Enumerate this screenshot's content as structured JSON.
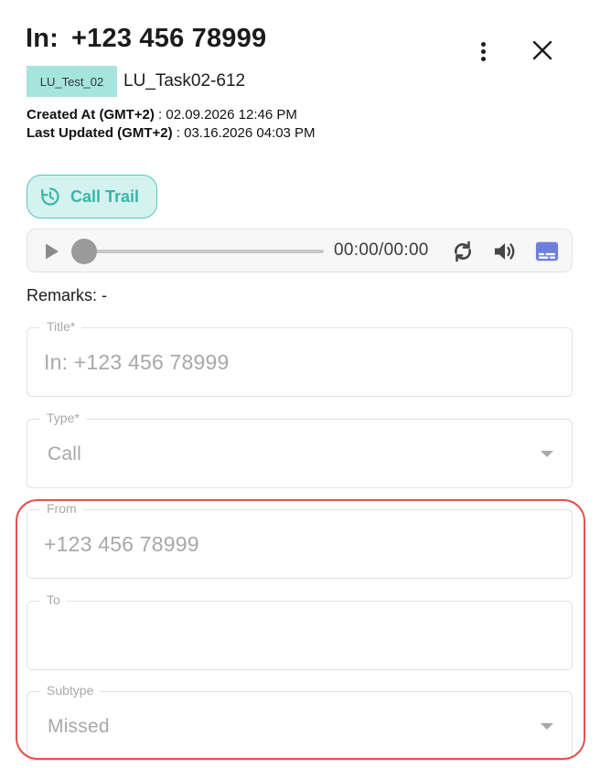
{
  "header": {
    "title_prefix": "In:",
    "title_number": "+123 456 78999",
    "more_icon": "more-vert-icon",
    "close_icon": "close-icon"
  },
  "tag": {
    "label": "LU_Test_02",
    "color": "#a6e4de"
  },
  "task_name": "LU_Task02-612",
  "meta": {
    "created_label": "Created At (GMT+2)",
    "created_value": " : 02.09.2026 12:46 PM",
    "updated_label": "Last Updated (GMT+2)",
    "updated_value": " : 03.16.2026 04:03 PM"
  },
  "call_trail": {
    "label": "Call Trail",
    "icon": "history-icon",
    "accent": "#3bb5a9"
  },
  "player": {
    "time": "00:00/00:00",
    "progress": 0,
    "icons": [
      "play-icon",
      "loop-icon",
      "volume-icon",
      "subtitles-icon"
    ],
    "subtitles_color": "#6e7fdb"
  },
  "remarks": "Remarks: -",
  "fields": {
    "title": {
      "label": "Title*",
      "value": "In: +123 456 78999"
    },
    "type": {
      "label": "Type*",
      "value": "Call"
    },
    "from": {
      "label": "From",
      "value": "+123 456 78999"
    },
    "to": {
      "label": "To",
      "value": ""
    },
    "subtype": {
      "label": "Subtype",
      "value": "Missed"
    }
  },
  "highlight_color": "#e3514c"
}
